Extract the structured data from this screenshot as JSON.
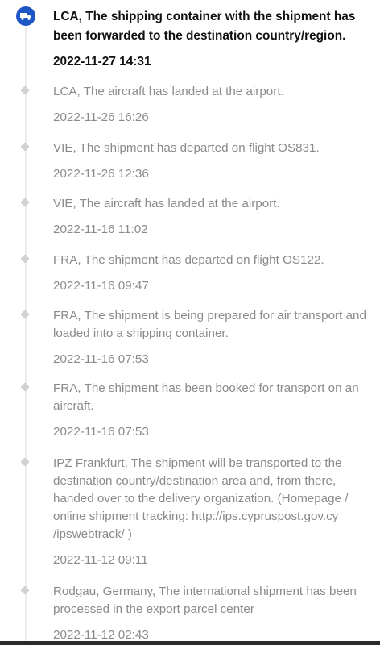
{
  "events": [
    {
      "text": "LCA, The shipping container with the shipment has been forwarded to the destination country/region.",
      "time": "2022-11-27 14:31"
    },
    {
      "text": "LCA, The aircraft has landed at the airport.",
      "time": "2022-11-26 16:26"
    },
    {
      "text": "VIE, The shipment has departed on flight OS831.",
      "time": "2022-11-26 12:36"
    },
    {
      "text": "VIE, The aircraft has landed at the airport.",
      "time": "2022-11-16 11:02"
    },
    {
      "text": "FRA, The shipment has departed on flight OS122.",
      "time": "2022-11-16 09:47"
    },
    {
      "text": "FRA, The shipment is being prepared for air transport and loaded into a shipping container.",
      "time": "2022-11-16 07:53"
    },
    {
      "text": "FRA, The shipment has been booked for transport on an aircraft.",
      "time": "2022-11-16 07:53"
    },
    {
      "text": "IPZ Frankfurt, The shipment will be transported to the destination country/destination area and, from there, handed over to the delivery organization. (Homepage / online shipment tracking: http://ips.cypruspost.gov.cy /ipswebtrack/ )",
      "time": "2022-11-12 09:11"
    },
    {
      "text": "Rodgau, Germany, The international shipment has been processed in the export parcel center",
      "time": "2022-11-12 02:43"
    }
  ],
  "icons": {
    "current_status": "truck-icon",
    "event_marker": "diamond-dot-icon"
  },
  "colors": {
    "accent": "#1f56c6",
    "primary_text": "#111111",
    "secondary_text": "#8a8a8a",
    "rail": "#eeeeee"
  }
}
